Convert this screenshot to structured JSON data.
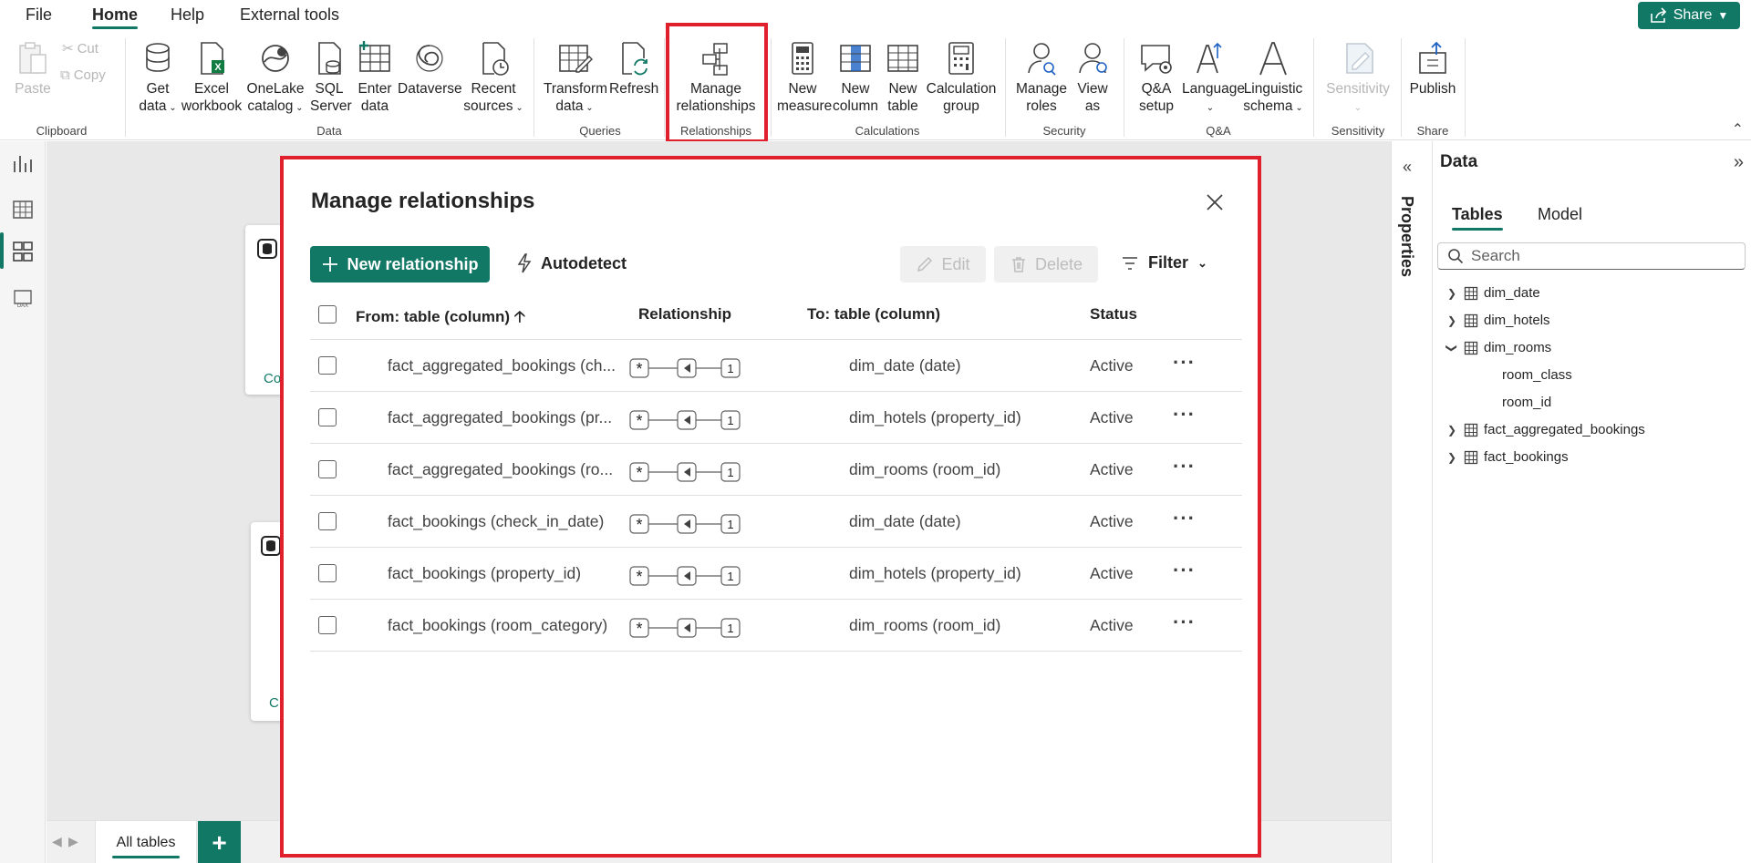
{
  "menu": {
    "file": "File",
    "home": "Home",
    "help": "Help",
    "external_tools": "External tools"
  },
  "share": {
    "label": "Share"
  },
  "ribbon": {
    "clipboard": {
      "paste": "Paste",
      "cut": "Cut",
      "copy": "Copy",
      "group": "Clipboard"
    },
    "data": {
      "get_data": [
        "Get",
        "data"
      ],
      "excel": [
        "Excel",
        "workbook"
      ],
      "onelake": [
        "OneLake",
        "catalog"
      ],
      "sql": [
        "SQL",
        "Server"
      ],
      "enter": [
        "Enter",
        "data"
      ],
      "dataverse": "Dataverse",
      "recent": [
        "Recent",
        "sources"
      ],
      "group": "Data"
    },
    "queries": {
      "transform": [
        "Transform",
        "data"
      ],
      "refresh": "Refresh",
      "group": "Queries"
    },
    "relationships": {
      "manage": [
        "Manage",
        "relationships"
      ],
      "group": "Relationships"
    },
    "calculations": {
      "new_measure": [
        "New",
        "measure"
      ],
      "new_column": [
        "New",
        "column"
      ],
      "new_table": [
        "New",
        "table"
      ],
      "calc_group": [
        "Calculation",
        "group"
      ],
      "group": "Calculations"
    },
    "security": {
      "manage_roles": [
        "Manage",
        "roles"
      ],
      "view_as": [
        "View",
        "as"
      ],
      "group": "Security"
    },
    "qa": {
      "qa_setup": [
        "Q&A",
        "setup"
      ],
      "language": "Language",
      "linguistic": [
        "Linguistic",
        "schema"
      ],
      "group": "Q&A"
    },
    "sensitivity": {
      "label": "Sensitivity",
      "group": "Sensitivity"
    },
    "share": {
      "publish": "Publish",
      "group": "Share"
    }
  },
  "canvas": {
    "cards": [
      {
        "label": "Co"
      },
      {
        "label": "C"
      }
    ]
  },
  "bottom": {
    "tab": "All tables",
    "add": "+"
  },
  "properties": {
    "label": "Properties"
  },
  "data_pane": {
    "title": "Data",
    "tabs": [
      "Tables",
      "Model"
    ],
    "search_placeholder": "Search",
    "tables": [
      {
        "name": "dim_date",
        "expanded": false
      },
      {
        "name": "dim_hotels",
        "expanded": false
      },
      {
        "name": "dim_rooms",
        "expanded": true,
        "columns": [
          "room_class",
          "room_id"
        ]
      },
      {
        "name": "fact_aggregated_bookings",
        "expanded": false
      },
      {
        "name": "fact_bookings",
        "expanded": false
      }
    ]
  },
  "modal": {
    "title": "Manage relationships",
    "new_relationship": "New relationship",
    "autodetect": "Autodetect",
    "edit": "Edit",
    "delete": "Delete",
    "filter": "Filter",
    "columns": {
      "from": "From: table (column)",
      "relationship": "Relationship",
      "to": "To: table (column)",
      "status": "Status"
    },
    "rows": [
      {
        "from": "fact_aggregated_bookings (ch...",
        "to": "dim_date (date)",
        "status": "Active"
      },
      {
        "from": "fact_aggregated_bookings (pr...",
        "to": "dim_hotels (property_id)",
        "status": "Active"
      },
      {
        "from": "fact_aggregated_bookings (ro...",
        "to": "dim_rooms (room_id)",
        "status": "Active"
      },
      {
        "from": "fact_bookings (check_in_date)",
        "to": "dim_date (date)",
        "status": "Active"
      },
      {
        "from": "fact_bookings (property_id)",
        "to": "dim_hotels (property_id)",
        "status": "Active"
      },
      {
        "from": "fact_bookings (room_category)",
        "to": "dim_rooms (room_id)",
        "status": "Active"
      }
    ],
    "cardinality": {
      "many": "*",
      "one": "1"
    }
  },
  "colors": {
    "accent": "#117865",
    "highlight": "#e0202c",
    "disabled": "#b6b6b6"
  }
}
